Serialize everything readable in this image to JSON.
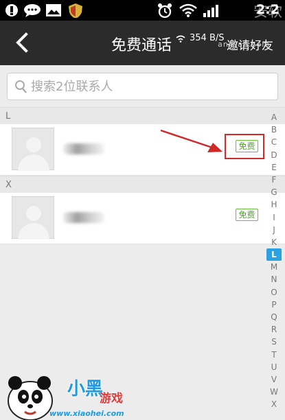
{
  "status_bar": {
    "time": "2:2",
    "watermark": "安软",
    "watermark_domain": "anruan.com"
  },
  "header": {
    "back_icon": "chevron-left-icon",
    "title": "免费通话",
    "network_speed": "354 B/S",
    "invite_label": "邀请好友"
  },
  "search": {
    "placeholder": "搜索2位联系人"
  },
  "sections": [
    {
      "letter": "L",
      "contacts": [
        {
          "name": "",
          "free_label": "免费",
          "highlighted": true
        }
      ]
    },
    {
      "letter": "X",
      "contacts": [
        {
          "name": "",
          "free_label": "免费",
          "highlighted": false
        }
      ]
    }
  ],
  "index_letters": [
    "A",
    "B",
    "C",
    "D",
    "E",
    "F",
    "G",
    "H",
    "I",
    "J",
    "K",
    "L",
    "M",
    "N",
    "O",
    "P",
    "Q",
    "R",
    "S",
    "T",
    "U",
    "V",
    "W",
    "X"
  ],
  "index_active": "L",
  "logo": {
    "word": "小黑",
    "word2": "游戏",
    "url": "www.xiaohei.com"
  },
  "colors": {
    "accent": "#2aa1e0",
    "free_green": "#4ea52a",
    "highlight_red": "#d12828",
    "header_bg": "#2b2b2b"
  }
}
